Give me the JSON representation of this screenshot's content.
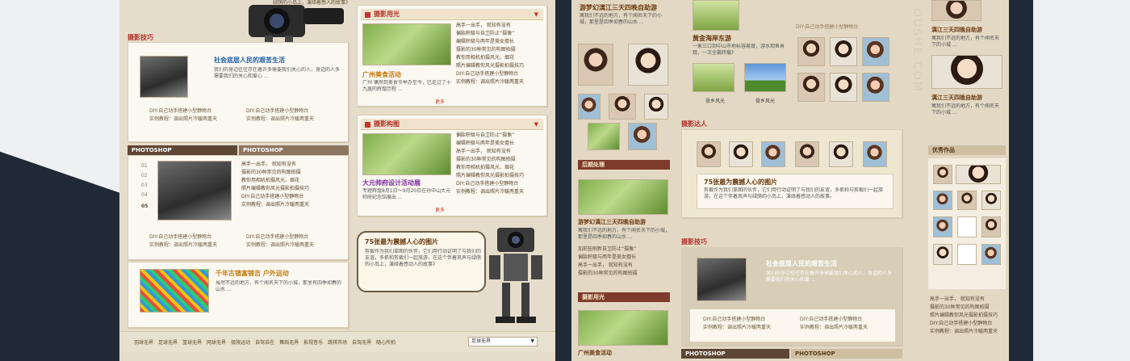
{
  "colors": {
    "accent_red": "#c2362e",
    "bg_page": "#e6dccb",
    "header_bg": "#efe3cc",
    "dark_strip": "#5b4734"
  },
  "left_page": {
    "top_text": "绿荫的小岛上，演绎着感人的故事》",
    "section_tips": "摄影技巧",
    "card1": {
      "title": "社会底层人民的艰苦生活",
      "text": "我们的身边往往存在着许多需要我们关心的人，身边的人多需要我们的关心和爱心 ...",
      "links_left": [
        "DIY:自己动手搭建小型静物台",
        "实例教程：调出照片冷暖两重天"
      ],
      "links_right": [
        "DIY:自己动手搭建小型静物台",
        "实例教程：调出照片冷暖两重天"
      ]
    },
    "tabs": [
      "PHOTOSHOP",
      "PHOTOSHOP"
    ],
    "numbers": [
      "01",
      "02",
      "03",
      "04",
      "05"
    ],
    "card2_lines": [
      "高手一出手，  就知有没有",
      "摄影的30种常见的构图拍摄",
      "教你用相机拍摄风光、烟花",
      "照片编辑教你风光摄影拍摄技巧",
      "DIY:自己动手搭建小型静物台",
      "实例教程：调出照片冷暖两重天"
    ],
    "card2_links_left": [
      "DIY:自己动手搭建小型静物台",
      "实例教程：调出照片冷暖两重天"
    ],
    "card2_links_right": [
      "DIY:自己动手搭建小型静物台",
      "实例教程：调出照片冷暖两重天"
    ],
    "card3": {
      "title": "千年古镇富锦吉  户外运动",
      "text": "虽然不远的地方，有个闻名天下的小城，那里有四季如春的山水 ..."
    },
    "panel_light": {
      "header": "摄影用光",
      "lines": [
        "高手一出手，  就知有没有",
        "偏胎积极与自卫防止“摄像”",
        "编辑积极与两年是美女擅长",
        "摄影的30种常见的构图拍摄",
        "教你用相机拍摄风光、烟花",
        "照片编辑教你风光摄影拍摄技巧"
      ],
      "title": "广州美食活动",
      "text": "广州 偶然到美食节举办至今，已走过了十九届的辉煌历程 ...",
      "links": [
        "DIY:自己动手搭建小型静物台",
        "实例教程：调出照片冷暖两重天"
      ],
      "more": "更多"
    },
    "panel_comp": {
      "header": "摄影构图",
      "lines": [
        "偏胎积极与自卫防止“摄像”",
        "编辑积极与两年是美女擅长",
        "高手一出手，  就知有没有",
        "摄影的30种常见的构图拍摄",
        "教你用相机拍摄风光、烟花",
        "照片编辑教你风光摄影拍摄技巧",
        "DIY:自己动手搭建小型静物台",
        "实例教程：调出照片冷暖两重天"
      ],
      "title": "大元帅府设计活动展",
      "text": "专题辉煌8月1日～9月20日在孙中山大元帅府纪念馆展出 ...",
      "more": "更多"
    },
    "bubble": {
      "title": "75张最为震撼人心的图片",
      "text": "剪裁作为我们拿图的伙伴，它们用行动证明了与我们的友谊，多抓和剪裁们一起旅游，在这个伴着风声与绿荫的小岛上，演绎着感动人的故事》"
    },
    "footer_links": [
      "羽球无界",
      "足球无界",
      "篮球无界",
      "网球无界",
      "极限运动",
      "自驾自在",
      "舞蹈无界",
      "影视音乐",
      "跳棋市场",
      "自驾无界",
      "随心所拍"
    ],
    "footer_select": "足球无界"
  },
  "right_page": {
    "top_title": "游梦幻漓江三天四晚自助游",
    "top_text": "寓我们不远的地方，有个闻名天下的小城，那里是四季如春的山水 ...",
    "side_post": "后期处理",
    "side_item_title": "游梦幻漓江三天四晚自助游",
    "side_item_text": "寓我们不远的地方，有个闻名天下的小城，那里是四季如春的山水 ...",
    "side_lines": [
      "加前些刷新自卫防止“摄像”",
      "偏胎积极与两年是美女擅长",
      "高手一出手，  就知有没有",
      "摄影的30种常见的构图拍摄"
    ],
    "side_light": "摄影用光",
    "side_light_title": "广州美食活动",
    "center_title": "黄金海岸东游",
    "center_text": "一家三口到中山市地标容易做，游水观鱼景观，一次全篇转载》",
    "captions": [
      "骨乡风光",
      "骨乡风光"
    ],
    "experts": "摄影达人",
    "expert_title": "75张最为震撼人心的图片",
    "expert_text": "剪裁作为我们拿图的伙伴，它们用行动证明了与我们的友谊，多抓和与剪裁们一起旅游，在这个伴着风声与绿荫的小岛上，演绎着感动人的故事。",
    "tips": "摄影技巧",
    "tips_card_title": "社会底层人民的艰苦生活",
    "tips_card_text": "我们的身边往往存在着许多需要我们关心的人，身边的人多需要我们的关心和爱 ...",
    "tips_links_left": [
      "DIY:自己动手搭建小型静物台",
      "实例教程：调出照片冷暖两重天"
    ],
    "tips_links_right": [
      "DIY:自己动手搭建小型静物台",
      "实例教程：调出照片冷暖两重天"
    ],
    "tabs": [
      "PHOTOSHOP",
      "PHOTOSHOP"
    ],
    "diy_line": "DIY:自己动手搭建小型静物台",
    "col_title": "漓江三天四晚自助游",
    "col_text": "寓我们不远的地方，有个闻名天下的小城 ...",
    "fine_works": "优秀作品",
    "right_lines": [
      "高手一出手，  就知有没有",
      "摄影的30种常见的构图拍摄",
      "照片编辑教你风光摄影拍摄技巧",
      "DIY:自己动手搭建小型静物台",
      "实例教程：调出照片冷暖两重天"
    ],
    "watermark": "OUSHE.COM"
  }
}
